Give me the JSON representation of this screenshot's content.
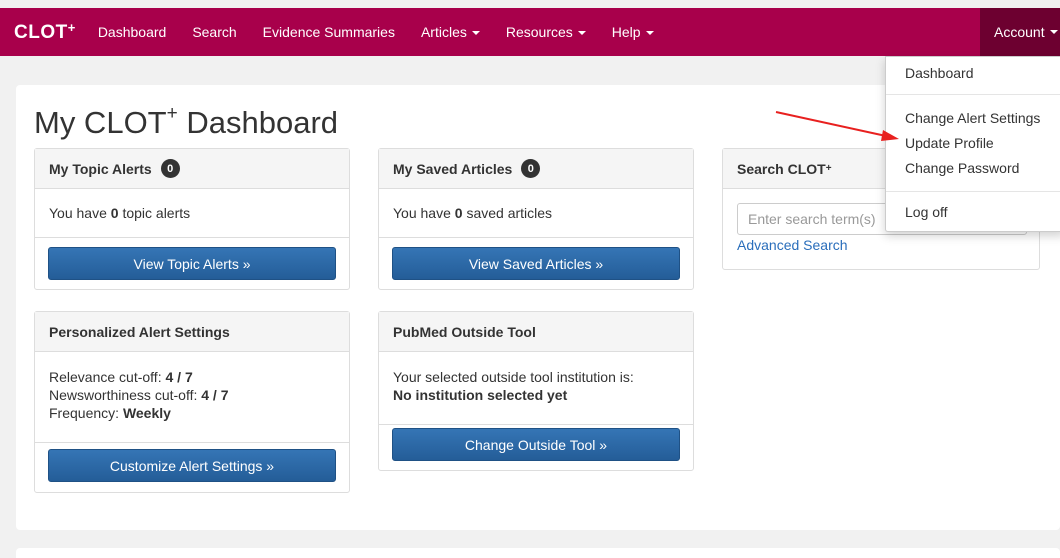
{
  "nav": {
    "brand": "CLOT",
    "brand_sup": "+",
    "items": [
      {
        "label": "Dashboard",
        "has_caret": false
      },
      {
        "label": "Search",
        "has_caret": false
      },
      {
        "label": "Evidence Summaries",
        "has_caret": false
      },
      {
        "label": "Articles",
        "has_caret": true
      },
      {
        "label": "Resources",
        "has_caret": true
      },
      {
        "label": "Help",
        "has_caret": true
      }
    ],
    "account_label": "Account"
  },
  "page": {
    "title": "My CLOT",
    "title_sup": "+",
    "title_suffix": " Dashboard"
  },
  "topic_alerts": {
    "title": "My Topic Alerts",
    "count": "0",
    "text_before": "You have ",
    "count_text": "0",
    "text_after": " topic alerts",
    "button": "View Topic Alerts »"
  },
  "saved_articles": {
    "title": "My Saved Articles",
    "count": "0",
    "text_before": "You have ",
    "count_text": "0",
    "text_after": " saved articles",
    "button": "View Saved Articles »"
  },
  "search_box": {
    "title": "Search CLOT",
    "title_sup": "+",
    "placeholder": "Enter search term(s)",
    "advanced_link": "Advanced Search"
  },
  "alert_settings": {
    "title": "Personalized Alert Settings",
    "relevance_label": "Relevance cut-off: ",
    "relevance_value": "4 / 7",
    "newsworthiness_label": "Newsworthiness cut-off: ",
    "newsworthiness_value": "4 / 7",
    "frequency_label": "Frequency: ",
    "frequency_value": "Weekly",
    "button": "Customize Alert Settings »"
  },
  "pubmed_tool": {
    "title": "PubMed Outside Tool",
    "line1": "Your selected outside tool institution is:",
    "line2": "No institution selected yet",
    "button": "Change Outside Tool »"
  },
  "account_menu": {
    "items": [
      "Dashboard",
      "Change Alert Settings",
      "Update Profile",
      "Change Password",
      "Log off"
    ]
  },
  "colors": {
    "navbar": "#a8004b",
    "account_active": "#6d0030",
    "button": "#2a67a6",
    "link": "#2a6ebb",
    "arrow": "#e8201f"
  }
}
